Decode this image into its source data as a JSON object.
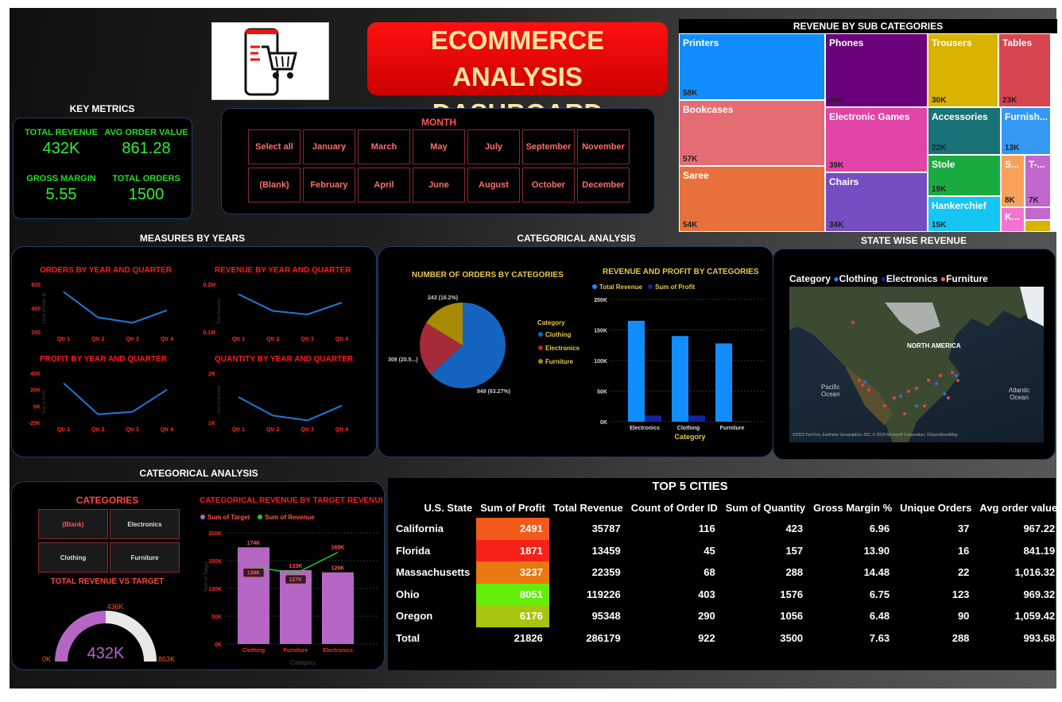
{
  "title": {
    "line1": "ECOMMERCE ANALYSIS",
    "line2": "DASHBOARD"
  },
  "logo_icon": "shopping-cart-phone-icon",
  "key_metrics": {
    "heading": "KEY METRICS",
    "items": [
      {
        "label": "TOTAL REVENUE",
        "value": "432K"
      },
      {
        "label": "AVG ORDER VALUE",
        "value": "861.28"
      },
      {
        "label": "GROSS MARGIN",
        "value": "5.55"
      },
      {
        "label": "TOTAL ORDERS",
        "value": "1500"
      }
    ]
  },
  "month_slicer": {
    "heading": "MONTH",
    "row1": [
      "Select all",
      "January",
      "March",
      "May",
      "July",
      "September",
      "November"
    ],
    "row2": [
      "(Blank)",
      "February",
      "April",
      "June",
      "August",
      "October",
      "December"
    ]
  },
  "treemap": {
    "heading": "REVENUE BY SUB CATEGORIES",
    "tiles": [
      {
        "name": "Printers",
        "value": "58K",
        "color": "#118DFF"
      },
      {
        "name": "Phones",
        "value": "46K",
        "color": "#6B007B"
      },
      {
        "name": "Trousers",
        "value": "30K",
        "color": "#D9B300"
      },
      {
        "name": "Tables",
        "value": "23K",
        "color": "#D64550"
      },
      {
        "name": "Bookcases",
        "value": "57K",
        "color": "#E66C74"
      },
      {
        "name": "Electronic Games",
        "value": "39K",
        "color": "#E044A7"
      },
      {
        "name": "Accessories",
        "value": "22K",
        "color": "#197278"
      },
      {
        "name": "Furnish...",
        "value": "13K",
        "color": "#3599F4"
      },
      {
        "name": "Saree",
        "value": "54K",
        "color": "#E8703A"
      },
      {
        "name": "Chairs",
        "value": "34K",
        "color": "#744EC2"
      },
      {
        "name": "Stole",
        "value": "19K",
        "color": "#1AAB40"
      },
      {
        "name": "S...",
        "value": "8K",
        "color": "#F9A05A"
      },
      {
        "name": "T-...",
        "value": "7K",
        "color": "#C267CE"
      },
      {
        "name": "Hankerchief",
        "value": "15K",
        "color": "#15C6F4"
      },
      {
        "name": "K...",
        "value": "",
        "color": "#F472D0"
      }
    ]
  },
  "measures_by_years": {
    "heading": "MEASURES BY YEARS",
    "quarters": [
      "Qtr 1",
      "Qtr 2",
      "Qtr 3",
      "Qtr 4"
    ],
    "orders": {
      "title": "ORDERS BY YEAR AND QUARTER",
      "yticks": [
        "600",
        "400",
        "200"
      ],
      "ylabel": "Count of Order ID",
      "values": [
        530,
        315,
        270,
        375
      ],
      "ylim": [
        200,
        600
      ]
    },
    "revenue": {
      "title": "REVENUE BY YEAR AND QUARTER",
      "yticks": [
        "0.2M",
        "0.1M"
      ],
      "ylabel": "Total Revenue",
      "values": [
        155000,
        85000,
        70000,
        120000
      ],
      "ylim": [
        0,
        200000
      ]
    },
    "profit": {
      "title": "PROFIT BY YEAR AND QUARTER",
      "yticks": [
        "40K",
        "20K",
        "0K",
        "-20K"
      ],
      "ylabel": "Sum of Profit",
      "values": [
        27000,
        -11000,
        -8000,
        19000
      ],
      "ylim": [
        -20000,
        40000
      ]
    },
    "quantity": {
      "title": "QUANTITY BY YEAR AND QUARTER",
      "yticks": [
        "2K",
        "1K"
      ],
      "ylabel": "Sum of Quantity",
      "values": [
        2000,
        1250,
        1050,
        1650
      ],
      "ylim": [
        1000,
        3000
      ]
    }
  },
  "categorical_analysis_top": {
    "heading": "CATEGORICAL ANALYSIS",
    "pie": {
      "title": "NUMBER OF ORDERS BY CATEGORIES",
      "legend_title": "Category",
      "labels": [
        "949 (63.27%)",
        "308 (20.5...)",
        "243 (16.2%)"
      ]
    },
    "bars": {
      "title": "REVENUE AND PROFIT BY CATEGORIES",
      "legend": [
        "Total Revenue",
        "Sum of Profit"
      ],
      "yticks": [
        "200K",
        "150K",
        "100K",
        "50K",
        "0K"
      ],
      "xlabel": "Category"
    }
  },
  "state_map": {
    "heading": "STATE WISE REVENUE",
    "legend_title": "Category",
    "legend": [
      "Clothing",
      "Electronics",
      "Furniture"
    ],
    "labels": {
      "continent": "NORTH AMERICA",
      "pacific": "Pacific\nOcean",
      "atlantic": "Atlantic\nOcean"
    },
    "attribution": "©2023 TomTom, Earthstar Geographics SIO, © 2024 Microsoft Corporation, ©OpenStreetMap"
  },
  "categorical_analysis_bottom": {
    "heading": "CATEGORICAL ANALYSIS",
    "slicer_title": "CATEGORIES",
    "slicer_items": [
      "(Blank)",
      "Electronics",
      "Clothing",
      "Furniture"
    ],
    "gauge": {
      "title": "TOTAL REVENUE VS TARGET",
      "value": "432K",
      "min": "0K",
      "max": "863K",
      "target": "436K",
      "fraction": 0.5
    },
    "combo": {
      "title": "CATEGORICAL REVENUE BY TARGET REVENUE",
      "legend": [
        "Sum of Target",
        "Sum of Revenue"
      ],
      "yticks": [
        "200K",
        "150K",
        "100K",
        "50K",
        "0K"
      ],
      "ylabel": "Sum of Target",
      "xlabel": "Category"
    }
  },
  "top_cities": {
    "heading": "TOP 5 CITIES",
    "columns": [
      "U.S. State",
      "Sum of Profit",
      "Total Revenue",
      "Count of Order ID",
      "Sum of Quantity",
      "Gross Margin %",
      "Unique Orders",
      "Avg order value"
    ],
    "rows": [
      {
        "cells": [
          "California",
          "2491",
          "35787",
          "116",
          "423",
          "6.96",
          "37",
          "967.22"
        ],
        "profit_color": "#F35A1A"
      },
      {
        "cells": [
          "Florida",
          "1871",
          "13459",
          "45",
          "157",
          "13.90",
          "16",
          "841.19"
        ],
        "profit_color": "#F7211A"
      },
      {
        "cells": [
          "Massachusetts",
          "3237",
          "22359",
          "68",
          "288",
          "14.48",
          "22",
          "1,016.32"
        ],
        "profit_color": "#E8780F"
      },
      {
        "cells": [
          "Ohio",
          "8051",
          "119226",
          "403",
          "1576",
          "6.75",
          "123",
          "969.32"
        ],
        "profit_color": "#63EE0A"
      },
      {
        "cells": [
          "Oregon",
          "6176",
          "95348",
          "290",
          "1056",
          "6.48",
          "90",
          "1,059.42"
        ],
        "profit_color": "#A9C40F"
      }
    ],
    "total": [
      "Total",
      "21826",
      "286179",
      "922",
      "3500",
      "7.63",
      "288",
      "993.68"
    ]
  },
  "chart_data": [
    {
      "type": "line",
      "title": "ORDERS BY YEAR AND QUARTER",
      "categories": [
        "Qtr 1",
        "Qtr 2",
        "Qtr 3",
        "Qtr 4"
      ],
      "values": [
        530,
        315,
        270,
        375
      ],
      "ylim": [
        200,
        600
      ],
      "ylabel": "Count of Order ID"
    },
    {
      "type": "line",
      "title": "REVENUE BY YEAR AND QUARTER",
      "categories": [
        "Qtr 1",
        "Qtr 2",
        "Qtr 3",
        "Qtr 4"
      ],
      "values": [
        155000,
        85000,
        70000,
        120000
      ],
      "ylim": [
        0,
        200000
      ],
      "ylabel": "Total Revenue"
    },
    {
      "type": "line",
      "title": "PROFIT BY YEAR AND QUARTER",
      "categories": [
        "Qtr 1",
        "Qtr 2",
        "Qtr 3",
        "Qtr 4"
      ],
      "values": [
        27000,
        -11000,
        -8000,
        19000
      ],
      "ylim": [
        -20000,
        40000
      ],
      "ylabel": "Sum of Profit"
    },
    {
      "type": "line",
      "title": "QUANTITY BY YEAR AND QUARTER",
      "categories": [
        "Qtr 1",
        "Qtr 2",
        "Qtr 3",
        "Qtr 4"
      ],
      "values": [
        2000,
        1250,
        1050,
        1650
      ],
      "ylim": [
        1000,
        3000
      ],
      "ylabel": "Sum of Quantity"
    },
    {
      "type": "pie",
      "title": "NUMBER OF ORDERS BY CATEGORIES",
      "categories": [
        "Clothing",
        "Electronics",
        "Furniture"
      ],
      "values": [
        949,
        308,
        243
      ],
      "colors": [
        "#1565C0",
        "#A52A3A",
        "#A88A00"
      ]
    },
    {
      "type": "bar",
      "title": "REVENUE AND PROFIT BY CATEGORIES",
      "categories": [
        "Electronics",
        "Clothing",
        "Furniture"
      ],
      "series": [
        {
          "name": "Total Revenue",
          "values": [
            165000,
            140000,
            128000
          ],
          "color": "#118DFF"
        },
        {
          "name": "Sum of Profit",
          "values": [
            10000,
            10000,
            1000
          ],
          "color": "#12239E"
        }
      ],
      "ylim": [
        0,
        200000
      ],
      "xlabel": "Category"
    },
    {
      "type": "bar",
      "title": "CATEGORICAL REVENUE BY TARGET REVENUE",
      "categories": [
        "Clothing",
        "Furniture",
        "Electronics"
      ],
      "series": [
        {
          "name": "Sum of Target",
          "values": [
            174000,
            133000,
            129000
          ],
          "color": "#B566C4"
        },
        {
          "name": "Sum of Revenue",
          "values": [
            139000,
            127000,
            165000
          ],
          "color": "#22CC33"
        }
      ],
      "ylim": [
        0,
        200000
      ],
      "ylabel": "Sum of Target",
      "xlabel": "Category"
    }
  ]
}
